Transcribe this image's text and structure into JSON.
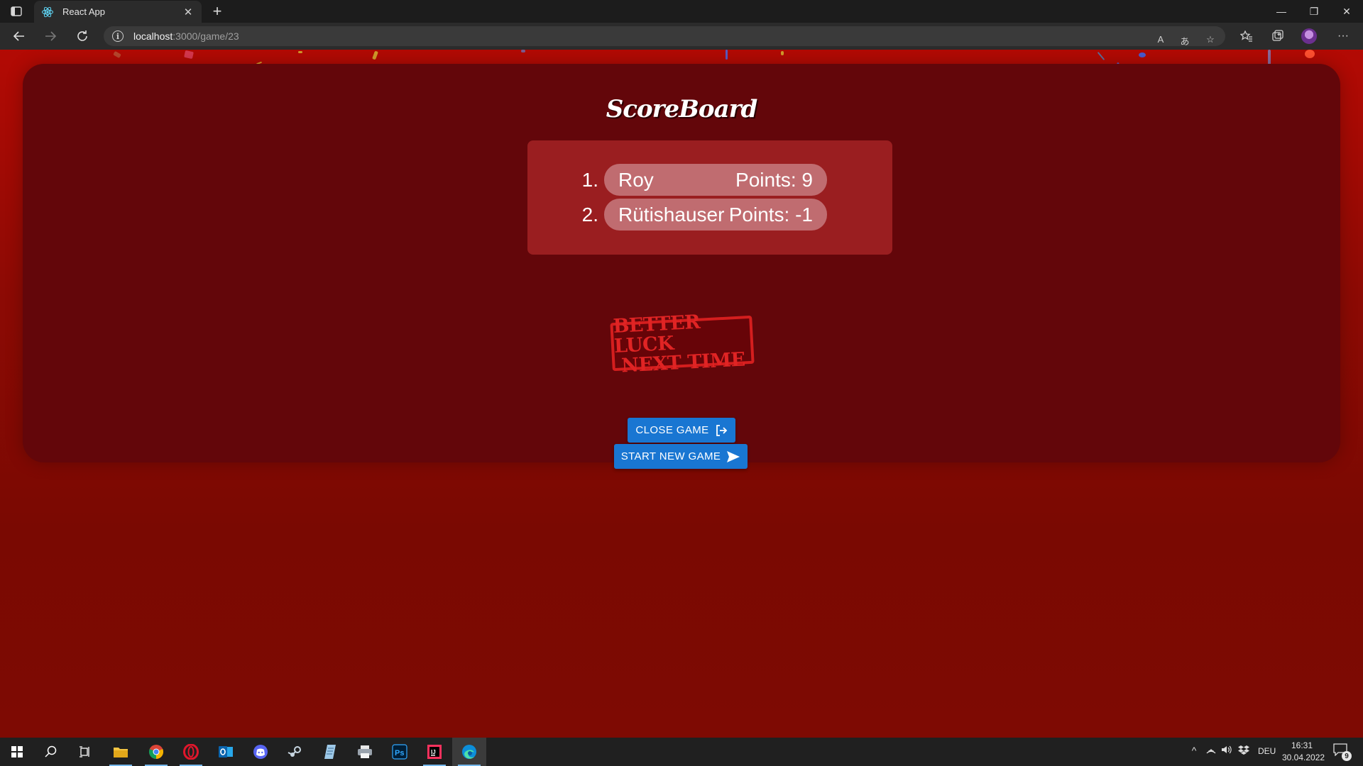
{
  "browser": {
    "tab_title": "React App",
    "tab_close": "✕",
    "new_tab": "+",
    "url_host": "localhost",
    "url_path": ":3000/game/23",
    "read_aloud": "A",
    "translate": "あ",
    "window": {
      "minimize": "—",
      "restore": "❐",
      "close": "✕"
    },
    "more": "···"
  },
  "page": {
    "title": "ScoreBoard",
    "scoreboard": [
      {
        "rank": "1.",
        "name": "Roy",
        "points": "Points: 9"
      },
      {
        "rank": "2.",
        "name": "Rütishauser",
        "points": "Points: -1"
      }
    ],
    "stamp": {
      "line1": "BETTER LUCK",
      "line2": "NEXT TIME"
    },
    "close_button": "CLOSE GAME",
    "new_game_button": "START NEW GAME"
  },
  "taskbar": {
    "apps": [
      "start-icon",
      "search-icon",
      "task-view-icon",
      "file-explorer-icon",
      "chrome-icon",
      "opera-icon",
      "outlook-icon",
      "discord-icon",
      "steam-icon",
      "notepad-icon",
      "printer-icon",
      "photoshop-icon",
      "intellij-icon",
      "edge-icon"
    ],
    "language": "DEU",
    "time": "16:31",
    "date": "30.04.2022",
    "notifications": "9"
  },
  "colors": {
    "background_top": "#b30a04",
    "background_bottom": "#7e0a03",
    "card": "#63060a",
    "scorebox": "#9a1e20",
    "pill": "#c06c70",
    "button": "#1976d2",
    "stamp": "#d41e1e"
  }
}
